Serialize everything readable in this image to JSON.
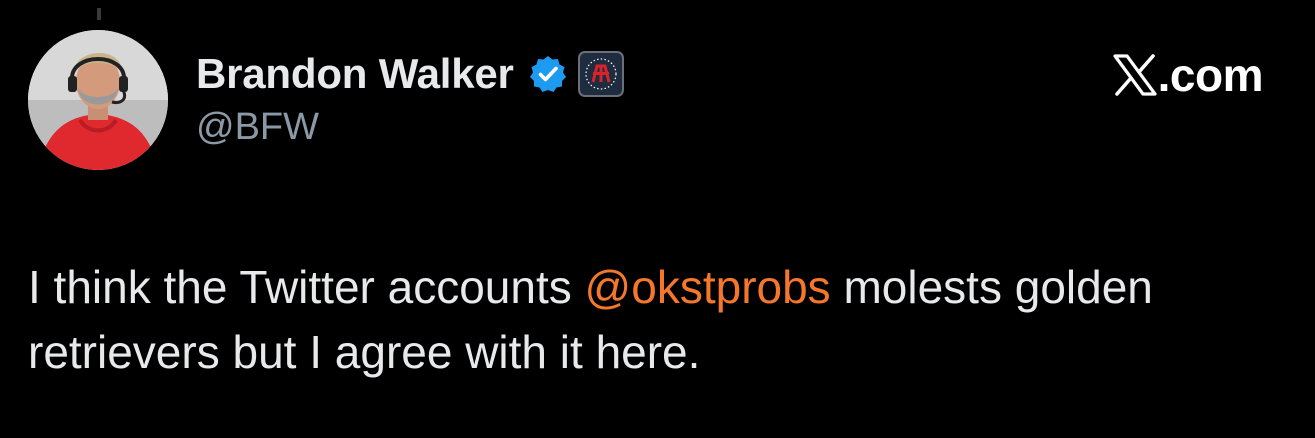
{
  "author": {
    "display_name": "Brandon Walker",
    "handle": "@BFW",
    "verified": true,
    "affiliate_badge": "barstool-affiliate-badge"
  },
  "brand": {
    "logo": "x-logo",
    "domain_suffix": ".com"
  },
  "tweet": {
    "text_before": "I think the Twitter accounts ",
    "mention": "@okstprobs",
    "text_after": " molests golden retrievers but I agree with it here."
  },
  "colors": {
    "background": "#000000",
    "text_primary": "#e7e9ea",
    "text_secondary": "#8b98a5",
    "mention": "#f4772c",
    "verified_blue": "#1d9bf0"
  }
}
